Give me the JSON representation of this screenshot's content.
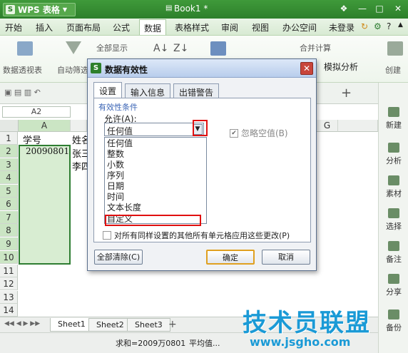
{
  "app": {
    "logo_letter": "S",
    "name": "WPS 表格",
    "dropdown_icon": "triangle-down",
    "doc_title": "Book1 *"
  },
  "window_controls": {
    "menu": "☰",
    "min": "—",
    "max": "□",
    "close": "✕"
  },
  "menubar": {
    "items": [
      "开始",
      "插入",
      "页面布局",
      "公式",
      "数据",
      "表格样式",
      "审阅",
      "视图",
      "办公空间"
    ],
    "active_index": 4,
    "login": "未登录"
  },
  "ribbon": {
    "pivot": "数据透视表",
    "autofilter": "自动筛选",
    "show_all": "全部显示",
    "merge_calc": "合并计算",
    "simulation": "模拟分析",
    "create": "创建"
  },
  "namebox": {
    "value": "A2"
  },
  "columns": [
    "A",
    "G"
  ],
  "rows": [
    "1",
    "2",
    "3",
    "4",
    "5",
    "6",
    "7",
    "8",
    "9",
    "10",
    "11",
    "12",
    "13",
    "14"
  ],
  "cells": {
    "a1": "学号",
    "a2": "20090801",
    "b1": "姓名",
    "b2": "张三",
    "b3": "李四"
  },
  "sheets": {
    "tabs": [
      "Sheet1",
      "Sheet2",
      "Sheet3"
    ],
    "add": "+"
  },
  "status": {
    "sum": "求和=2009万0801",
    "avg": "平均值..."
  },
  "side_panel": [
    "新建",
    "分析",
    "素材",
    "选择",
    "备注",
    "分享",
    "备份"
  ],
  "dialog": {
    "logo_letter": "S",
    "title": "数据有效性",
    "close": "✕",
    "tabs": [
      "设置",
      "输入信息",
      "出错警告"
    ],
    "section": "有效性条件",
    "allow_label": "允许(A):",
    "allow_value": "任何值",
    "options": [
      "任何值",
      "整数",
      "小数",
      "序列",
      "日期",
      "时间",
      "文本长度",
      "自定义"
    ],
    "ignore_blank": "忽略空值(B)",
    "apply_all": "对所有同样设置的其他所有单元格应用这些更改(P)",
    "clear_all": "全部清除(C)",
    "ok": "确定",
    "cancel": "取消"
  },
  "watermark": {
    "text": "技术员联盟",
    "url": "www.jsgho.com"
  }
}
